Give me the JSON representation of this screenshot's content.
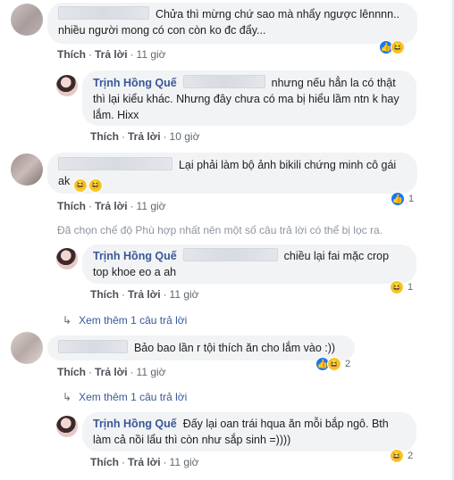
{
  "comments": [
    {
      "text": "Chửa thì mừng chứ sao mà nhẩy ngược lênnnn.. nhiều người mong có con còn ko đc đẩy...",
      "text_line1": "Chửa thì mừng chứ sao mà nhẩy ngược lênnnn..",
      "text_line2": "nhiều người mong có con còn ko đc đẩy...",
      "like_label": "Thích",
      "reply_label": "Trả lời",
      "time": "11 giờ",
      "reactions": [
        "like-icon",
        "haha-icon"
      ],
      "reaction_count": ""
    },
    {
      "author": "Trịnh Hồng Quế",
      "text_line1": "nhưng nếu hẳn la có thật",
      "text_line2": "thì lại kiểu khác. Nhưng đây chưa có ma bị hiểu lầm ntn k hay",
      "text_line3": "lắm. Hixx",
      "like_label": "Thích",
      "reply_label": "Trả lời",
      "time": "10 giờ"
    },
    {
      "text_line1": "Lại phải làm bộ ảnh bikili chứng minh cô gái",
      "text_line2": "ak",
      "like_label": "Thích",
      "reply_label": "Trả lời",
      "time": "11 giờ",
      "reaction_count": "1"
    },
    {
      "author": "Trịnh Hồng Quế",
      "text_line1": "chiều lại fai mặc crop",
      "text_line2": "top khoe eo a ah",
      "like_label": "Thích",
      "reply_label": "Trả lời",
      "time": "11 giờ",
      "reaction_count": "1"
    },
    {
      "text_line1": "Bảo bao lần r tội thích ăn cho lắm vào :))",
      "like_label": "Thích",
      "reply_label": "Trả lời",
      "time": "11 giờ",
      "reaction_count": "2"
    },
    {
      "author": "Trịnh Hồng Quế",
      "text_line1": "Đấy lại oan trái hqua ăn mỗi bắp ngô. Bth",
      "text_line2": "làm cả nồi lẩu thì còn như sắp sinh =))))",
      "like_label": "Thích",
      "reply_label": "Trả lời",
      "time": "11 giờ",
      "reaction_count": "2"
    }
  ],
  "filter_notice": "Đã chọn chế độ Phù hợp nhất nên một số câu trả lời có thể bị lọc ra.",
  "view_more_1": "Xem thêm 1 câu trả lời",
  "view_more_2": "Xem thêm 1 câu trả lời",
  "colors": {
    "link": "#385898",
    "bubble": "#f2f3f5",
    "like": "#1877f2",
    "haha": "#f7c928"
  }
}
